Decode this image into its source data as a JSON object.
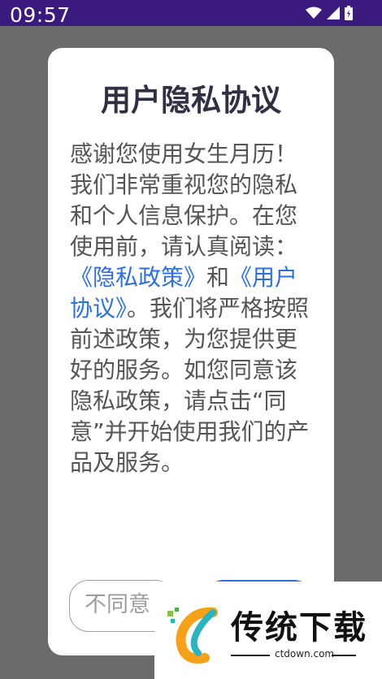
{
  "status_bar": {
    "time": "09:57",
    "icons": [
      "wifi-icon",
      "signal-icon",
      "battery-icon"
    ]
  },
  "dialog": {
    "title": "用户隐私协议",
    "body": {
      "intro": "感谢您使用女生月历！",
      "para1": "我们非常重视您的隐私和个人信息保护。在您使用前，请认真阅读：",
      "privacy_link": "《隐私政策》",
      "and": "和",
      "agreement_link": "《用户协议》",
      "para2": "。我们将严格按照前述政策，为您提供更好的服务。如您同意该隐私政策，请点击“同意”并开始使用我们的产品及服务。"
    },
    "buttons": {
      "disagree": "不同意",
      "agree": ""
    },
    "colors": {
      "link": "#2f6fd8",
      "title": "#2f3041",
      "body": "#555555"
    }
  },
  "watermark": {
    "name": "传统下载",
    "domain": "ctdown.com"
  }
}
